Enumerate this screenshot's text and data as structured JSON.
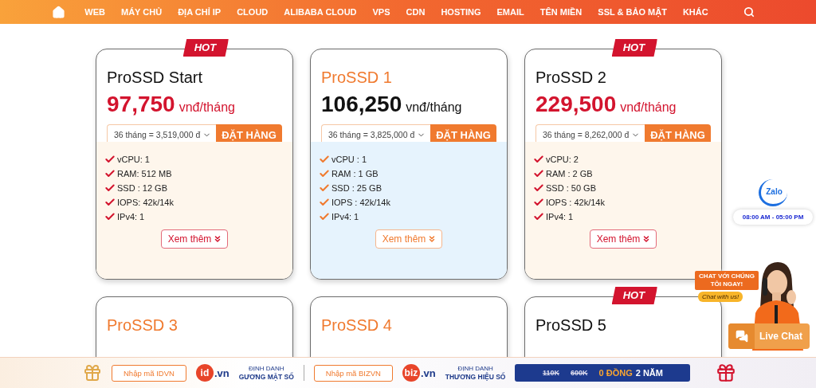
{
  "nav": {
    "items": [
      "WEB",
      "MÁY CHỦ",
      "ĐỊA CHỈ IP",
      "CLOUD",
      "ALIBABA CLOUD",
      "VPS",
      "CDN",
      "HOSTING",
      "EMAIL",
      "TÊN MIỀN",
      "SSL & BẢO MẬT",
      "KHÁC"
    ]
  },
  "plans": [
    {
      "name": "ProSSD Start",
      "hot": true,
      "badge": "HOT",
      "price": "97,750",
      "unit": "vnđ/tháng",
      "term": "36 tháng = 3,519,000 đ",
      "order": "ĐẶT HÀNG",
      "features": [
        "vCPU: 1",
        "RAM: 512 MB",
        "SSD : 12 GB",
        "IOPS: 42k/14k",
        "IPv4: 1"
      ],
      "more": "Xem thêm"
    },
    {
      "name": "ProSSD 1",
      "hot": false,
      "price": "106,250",
      "unit": "vnđ/tháng",
      "term": "36 tháng = 3,825,000 đ",
      "order": "ĐẶT HÀNG",
      "features": [
        "vCPU : 1",
        "RAM : 1 GB",
        "SSD : 25 GB",
        "IOPS : 42k/14k",
        "IPv4: 1"
      ],
      "more": "Xem thêm"
    },
    {
      "name": "ProSSD 2",
      "hot": true,
      "badge": "HOT",
      "price": "229,500",
      "unit": "vnđ/tháng",
      "term": "36 tháng = 8,262,000 đ",
      "order": "ĐẶT HÀNG",
      "features": [
        "vCPU: 2",
        "RAM : 2 GB",
        "SSD : 50 GB",
        "IOPS : 42k/14k",
        "IPv4: 1"
      ],
      "more": "Xem thêm"
    },
    {
      "name": "ProSSD 3",
      "hot": false
    },
    {
      "name": "ProSSD 4",
      "hot": false
    },
    {
      "name": "ProSSD 5",
      "hot": true,
      "badge": "HOT"
    }
  ],
  "chat": {
    "zalo": "Zalo",
    "hours": "08:00 AM - 05:00 PM",
    "bubble": "CHAT VỚI CHÚNG TÔI NGAY!",
    "bubble_sub": "Chat with us!",
    "button": "Live Chat"
  },
  "promo": {
    "groups": [
      {
        "code": "Nhập mã IDVN",
        "logo_mark": "id",
        "logo_suffix": ".vn",
        "tagline_top": "ĐỊNH DANH",
        "tagline_bottom": "GƯƠNG MẶT SỐ"
      },
      {
        "code": "Nhập mã BIZVN",
        "logo_mark": "biz",
        "logo_suffix": ".vn",
        "tagline_top": "ĐỊNH DANH",
        "tagline_bottom": "THƯƠNG HIỆU SỐ"
      }
    ],
    "deal": {
      "old_prices": [
        "110K",
        "600K"
      ],
      "offer": "0 ĐỒNG",
      "term": "2 NĂM"
    }
  }
}
